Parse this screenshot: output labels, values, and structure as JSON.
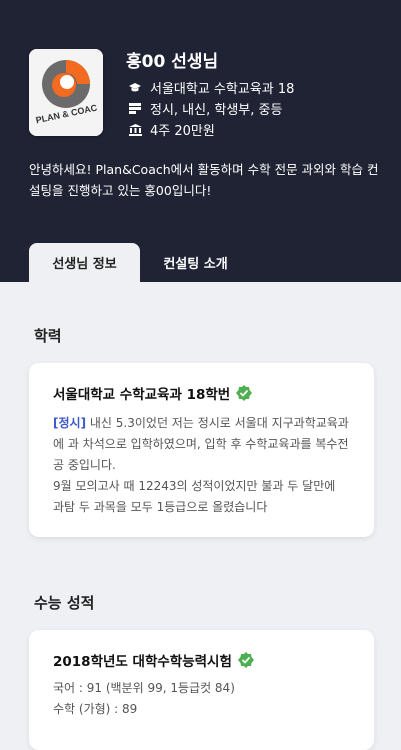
{
  "teacher": {
    "logo_text": "PLAN & COAC",
    "name": "홍00 선생님",
    "school": "서울대학교 수학교육과 18",
    "subjects": "정시, 내신, 학생부, 중등",
    "price": "4주 20만원",
    "intro": "안녕하세요! Plan&Coach에서 활동하며 수학 전문 과외와 학습 컨설팅을 진행하고 있는 홍00입니다!"
  },
  "tabs": [
    {
      "label": "선생님 정보",
      "active": true
    },
    {
      "label": "컨설팅 소개",
      "active": false
    }
  ],
  "education": {
    "section_title": "학력",
    "title": "서울대학교 수학교육과 18학번",
    "tag": "[정시]",
    "lines": [
      "내신 5.3이었던 저는 정시로 서울대 지구과학교육과에 과 차석으로 입학하였으며, 입학 후 수학교육과를 복수전공 중입니다.",
      "9월 모의고사 때 12243의 성적이었지만 불과 두 달만에 과탐 두 과목을 모두 1등급으로 올렸습니다"
    ]
  },
  "csat": {
    "section_title": "수능 성적",
    "title": "2018학년도 대학수학능력시험",
    "scores": [
      "국어 : 91 (백분위 99, 1등급컷 84)",
      "수학 (가형) : 89"
    ]
  },
  "colors": {
    "header_bg": "#1f2334",
    "verified_green": "#4caf50",
    "tag_blue": "#3b59c8",
    "logo_orange": "#f26b21"
  }
}
